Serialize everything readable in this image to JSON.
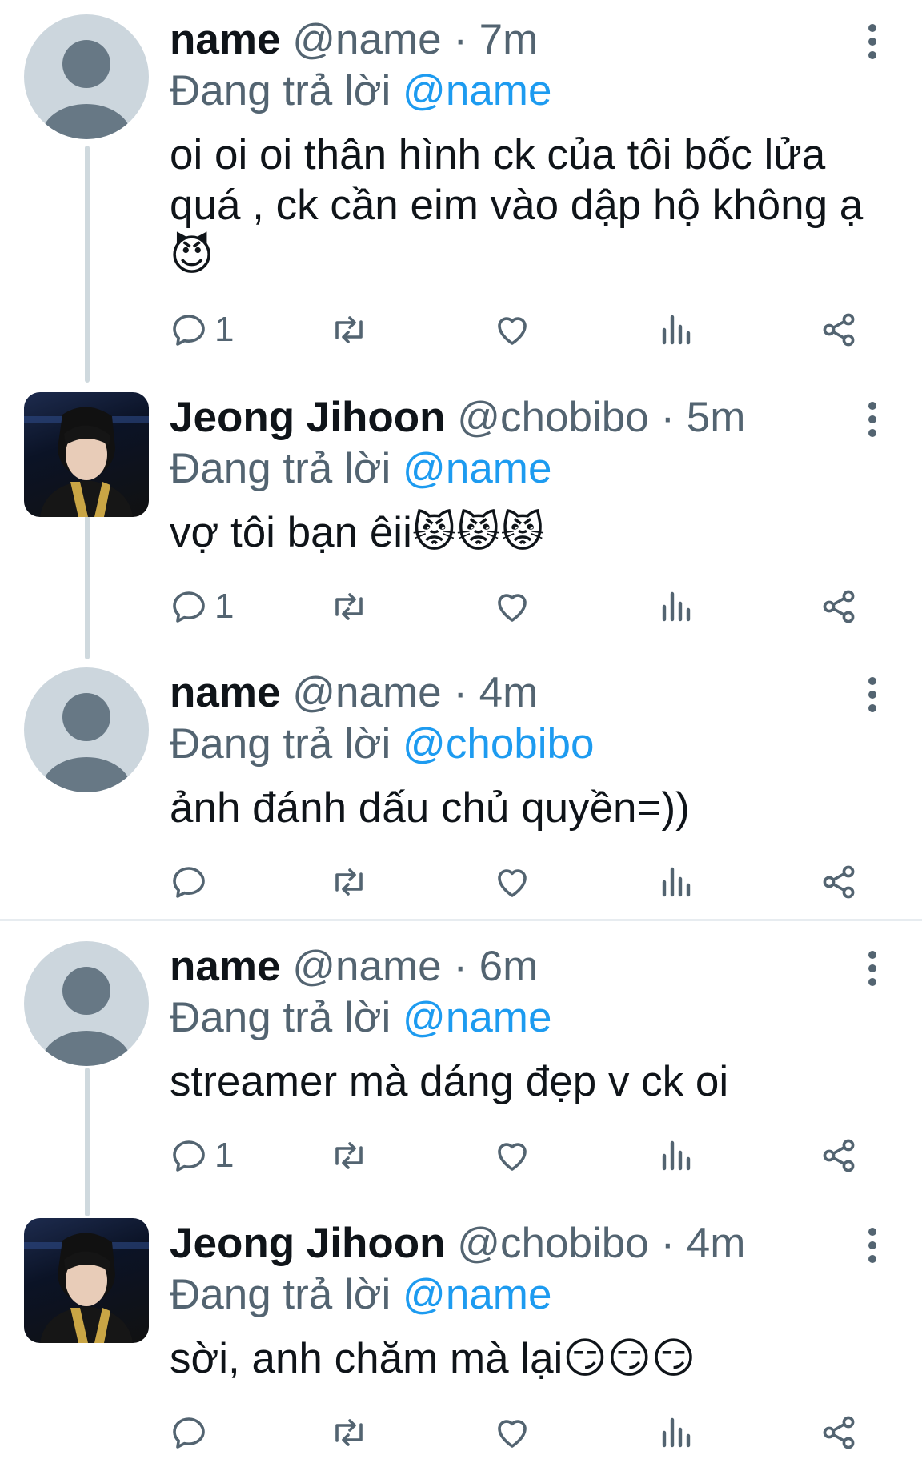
{
  "tweets": [
    {
      "author": "name",
      "handle": "@name",
      "time": "· 7m",
      "replying_prefix": "Đang trả lời",
      "replying_to": "@name",
      "text": "oi oi oi thân hình ck của tôi bốc lửa quá , ck cần eim vào dập hộ không ạ",
      "emoji": "😈",
      "reply_count": "1",
      "avatar": "default-avatar"
    },
    {
      "author": "Jeong Jihoon",
      "handle": "@chobibo",
      "time": "· 5m",
      "replying_prefix": "Đang trả lời",
      "replying_to": "@name",
      "text": "vợ tôi bạn êii",
      "emoji": "😾😾😾",
      "reply_count": "1",
      "avatar": "photo-avatar"
    },
    {
      "author": "name",
      "handle": "@name",
      "time": "· 4m",
      "replying_prefix": "Đang trả lời",
      "replying_to": "@chobibo",
      "text": "ảnh đánh dấu chủ quyền=))",
      "emoji": "",
      "reply_count": "",
      "avatar": "default-avatar"
    },
    {
      "author": "name",
      "handle": "@name",
      "time": "· 6m",
      "replying_prefix": "Đang trả lời",
      "replying_to": "@name",
      "text": "streamer mà dáng đẹp v ck oi",
      "emoji": "",
      "reply_count": "1",
      "avatar": "default-avatar"
    },
    {
      "author": "Jeong Jihoon",
      "handle": "@chobibo",
      "time": "· 4m",
      "replying_prefix": "Đang trả lời",
      "replying_to": "@name",
      "text": "sời, anh chăm mà lại",
      "emoji": "😏😏😏",
      "reply_count": "",
      "avatar": "photo-avatar"
    }
  ],
  "icons": [
    "reply-icon",
    "retweet-icon",
    "like-icon",
    "views-icon",
    "share-icon",
    "more-icon"
  ],
  "colors": {
    "link": "#1d9bf0",
    "secondary": "#536471",
    "text": "#0f1419",
    "thread_line": "#cfd9de"
  }
}
